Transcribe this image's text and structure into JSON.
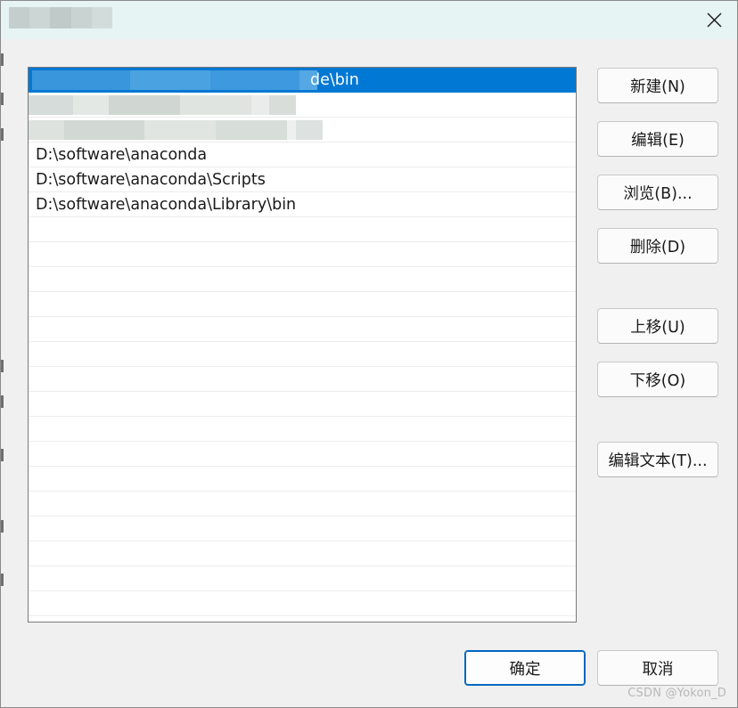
{
  "dialog": {
    "close_label": "✕"
  },
  "path_list": {
    "items": [
      {
        "text": "de\\bin",
        "state": "selected",
        "redacted": true
      },
      {
        "text": "",
        "state": "normal",
        "redacted": true
      },
      {
        "text": "",
        "state": "normal",
        "redacted": true
      },
      {
        "text": "D:\\software\\anaconda",
        "state": "normal",
        "redacted": false
      },
      {
        "text": "D:\\software\\anaconda\\Scripts",
        "state": "normal",
        "redacted": false
      },
      {
        "text": "D:\\software\\anaconda\\Library\\bin",
        "state": "normal",
        "redacted": false
      }
    ],
    "empty_rows": 16
  },
  "buttons": {
    "new": "新建(N)",
    "edit": "编辑(E)",
    "browse": "浏览(B)...",
    "delete": "删除(D)",
    "move_up": "上移(U)",
    "move_down": "下移(O)",
    "edit_text": "编辑文本(T)...",
    "ok": "确定",
    "cancel": "取消"
  },
  "watermark": "CSDN @Yokon_D",
  "colors": {
    "titlebar": "#e6f4f3",
    "selection": "#0078d4",
    "primary_border": "#0067c0",
    "dialog_bg": "#f0f0f0"
  }
}
